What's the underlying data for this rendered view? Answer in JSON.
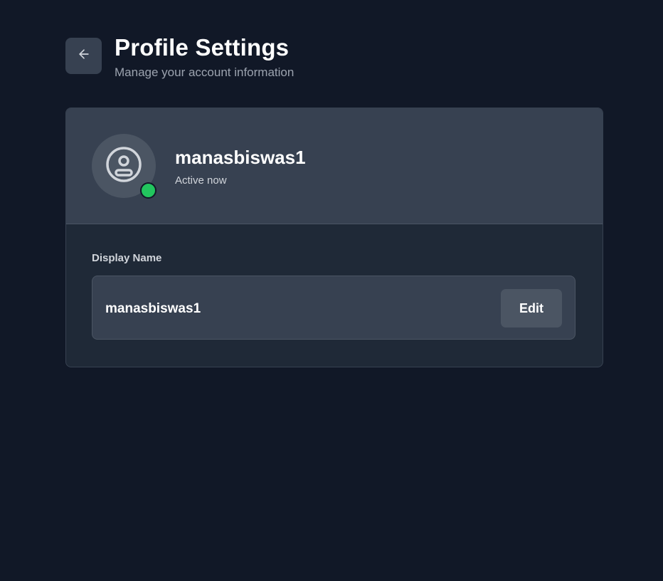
{
  "header": {
    "title": "Profile Settings",
    "subtitle": "Manage your account information",
    "back_icon": "arrow-left-icon"
  },
  "profile": {
    "username": "manasbiswas1",
    "status": "Active now",
    "avatar_icon": "user-circle-icon",
    "status_color": "#22c55e"
  },
  "display_name": {
    "label": "Display Name",
    "value": "manasbiswas1",
    "edit_label": "Edit"
  },
  "colors": {
    "background": "#111827",
    "card": "#1f2937",
    "card_header": "#374151",
    "button": "#4b5563"
  }
}
